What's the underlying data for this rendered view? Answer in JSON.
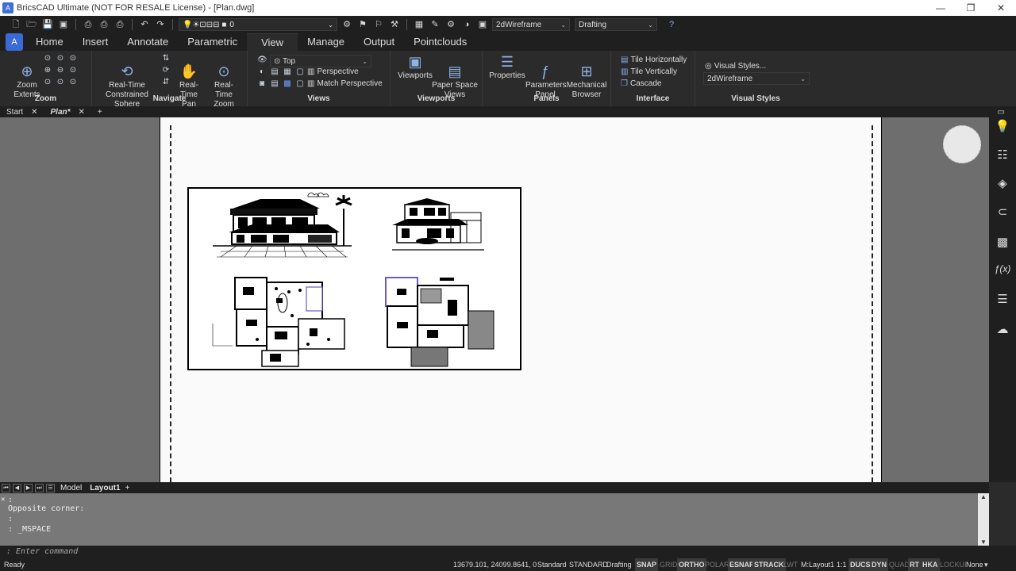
{
  "window": {
    "title": "BricsCAD Ultimate (NOT FOR RESALE License) - [Plan.dwg]",
    "app_icon": "A",
    "controls": [
      "—",
      "❐",
      "✕"
    ]
  },
  "qat": {
    "layer": "0",
    "visual_style": "2dWireframe",
    "workspace": "Drafting"
  },
  "ribbon_tabs": [
    {
      "label": "Home"
    },
    {
      "label": "Insert"
    },
    {
      "label": "Annotate"
    },
    {
      "label": "Parametric"
    },
    {
      "label": "View"
    },
    {
      "label": "Manage"
    },
    {
      "label": "Output"
    },
    {
      "label": "Pointclouds"
    }
  ],
  "active_tab": "View",
  "panels": {
    "zoom": {
      "title": "Zoom",
      "extents": "Zoom\nExtents"
    },
    "navigate": {
      "title": "Navigate",
      "sphere": "Real-Time\nConstrained Sphere",
      "pan": "Real-Time\nPan",
      "zoom": "Real-Time\nZoom"
    },
    "views": {
      "title": "Views",
      "view": "Top",
      "perspective": "Perspective",
      "match": "Match Perspective"
    },
    "viewports": {
      "title": "Viewports",
      "viewports": "Viewports",
      "paper_space": "Paper Space\nViews"
    },
    "panels": {
      "title": "Panels",
      "properties": "Properties",
      "parameters": "Parameters\nPanel",
      "mechanical": "Mechanical\nBrowser"
    },
    "interface": {
      "title": "Interface",
      "tile_h": "Tile Horizontally",
      "tile_v": "Tile Vertically",
      "cascade": "Cascade"
    },
    "visual_styles": {
      "title": "Visual Styles",
      "button": "Visual Styles...",
      "current": "2dWireframe"
    }
  },
  "doc_tabs": [
    {
      "label": "Start",
      "active": false
    },
    {
      "label": "Plan*",
      "active": true
    }
  ],
  "layout_tabs": {
    "model": "Model",
    "layout1": "Layout1",
    "add": "+"
  },
  "command_history": [
    ":",
    "Opposite corner:",
    ":",
    ": _MSPACE"
  ],
  "command_prompt": ": Enter command",
  "status": {
    "ready": "Ready",
    "coords": "13679.101, 24099.8641, 0",
    "items": [
      {
        "label": "Standard",
        "state": "plain"
      },
      {
        "label": "STANDARD",
        "state": "plain"
      },
      {
        "label": "Drafting",
        "state": "plain"
      },
      {
        "label": "SNAP",
        "state": "on"
      },
      {
        "label": "GRID",
        "state": "off"
      },
      {
        "label": "ORTHO",
        "state": "on"
      },
      {
        "label": "POLAR",
        "state": "off"
      },
      {
        "label": "ESNAP",
        "state": "on"
      },
      {
        "label": "STRACK",
        "state": "on"
      },
      {
        "label": "LWT",
        "state": "off"
      },
      {
        "label": "M:Layout1",
        "state": "plain"
      },
      {
        "label": "1:1",
        "state": "plain"
      },
      {
        "label": "DUCS",
        "state": "on"
      },
      {
        "label": "DYN",
        "state": "on"
      },
      {
        "label": "QUAD",
        "state": "off"
      },
      {
        "label": "RT",
        "state": "on"
      },
      {
        "label": "HKA",
        "state": "on"
      },
      {
        "label": "LOCKUI",
        "state": "off"
      },
      {
        "label": "None",
        "state": "plain"
      }
    ]
  },
  "right_bar_icons": [
    "lightbulb-icon",
    "sliders-icon",
    "layers-icon",
    "paperclip-icon",
    "hatch-icon",
    "function-icon",
    "structure-icon",
    "cloud-icon"
  ]
}
